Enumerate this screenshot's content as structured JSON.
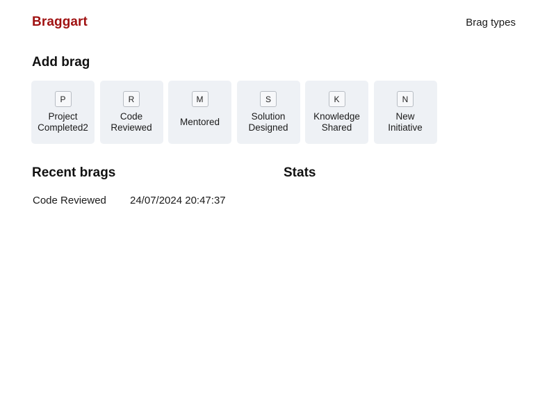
{
  "header": {
    "brand": "Braggart",
    "nav_link": "Brag types"
  },
  "add_brag": {
    "title": "Add brag",
    "types": [
      {
        "key": "P",
        "label": "Project\nCompleted2"
      },
      {
        "key": "R",
        "label": "Code\nReviewed"
      },
      {
        "key": "M",
        "label": "Mentored"
      },
      {
        "key": "S",
        "label": "Solution\nDesigned"
      },
      {
        "key": "K",
        "label": "Knowledge\nShared"
      },
      {
        "key": "N",
        "label": "New\nInitiative"
      }
    ]
  },
  "recent": {
    "title": "Recent brags",
    "items": [
      {
        "type": "Code Reviewed",
        "timestamp": "24/07/2024 20:47:37"
      }
    ]
  },
  "stats": {
    "title": "Stats"
  }
}
